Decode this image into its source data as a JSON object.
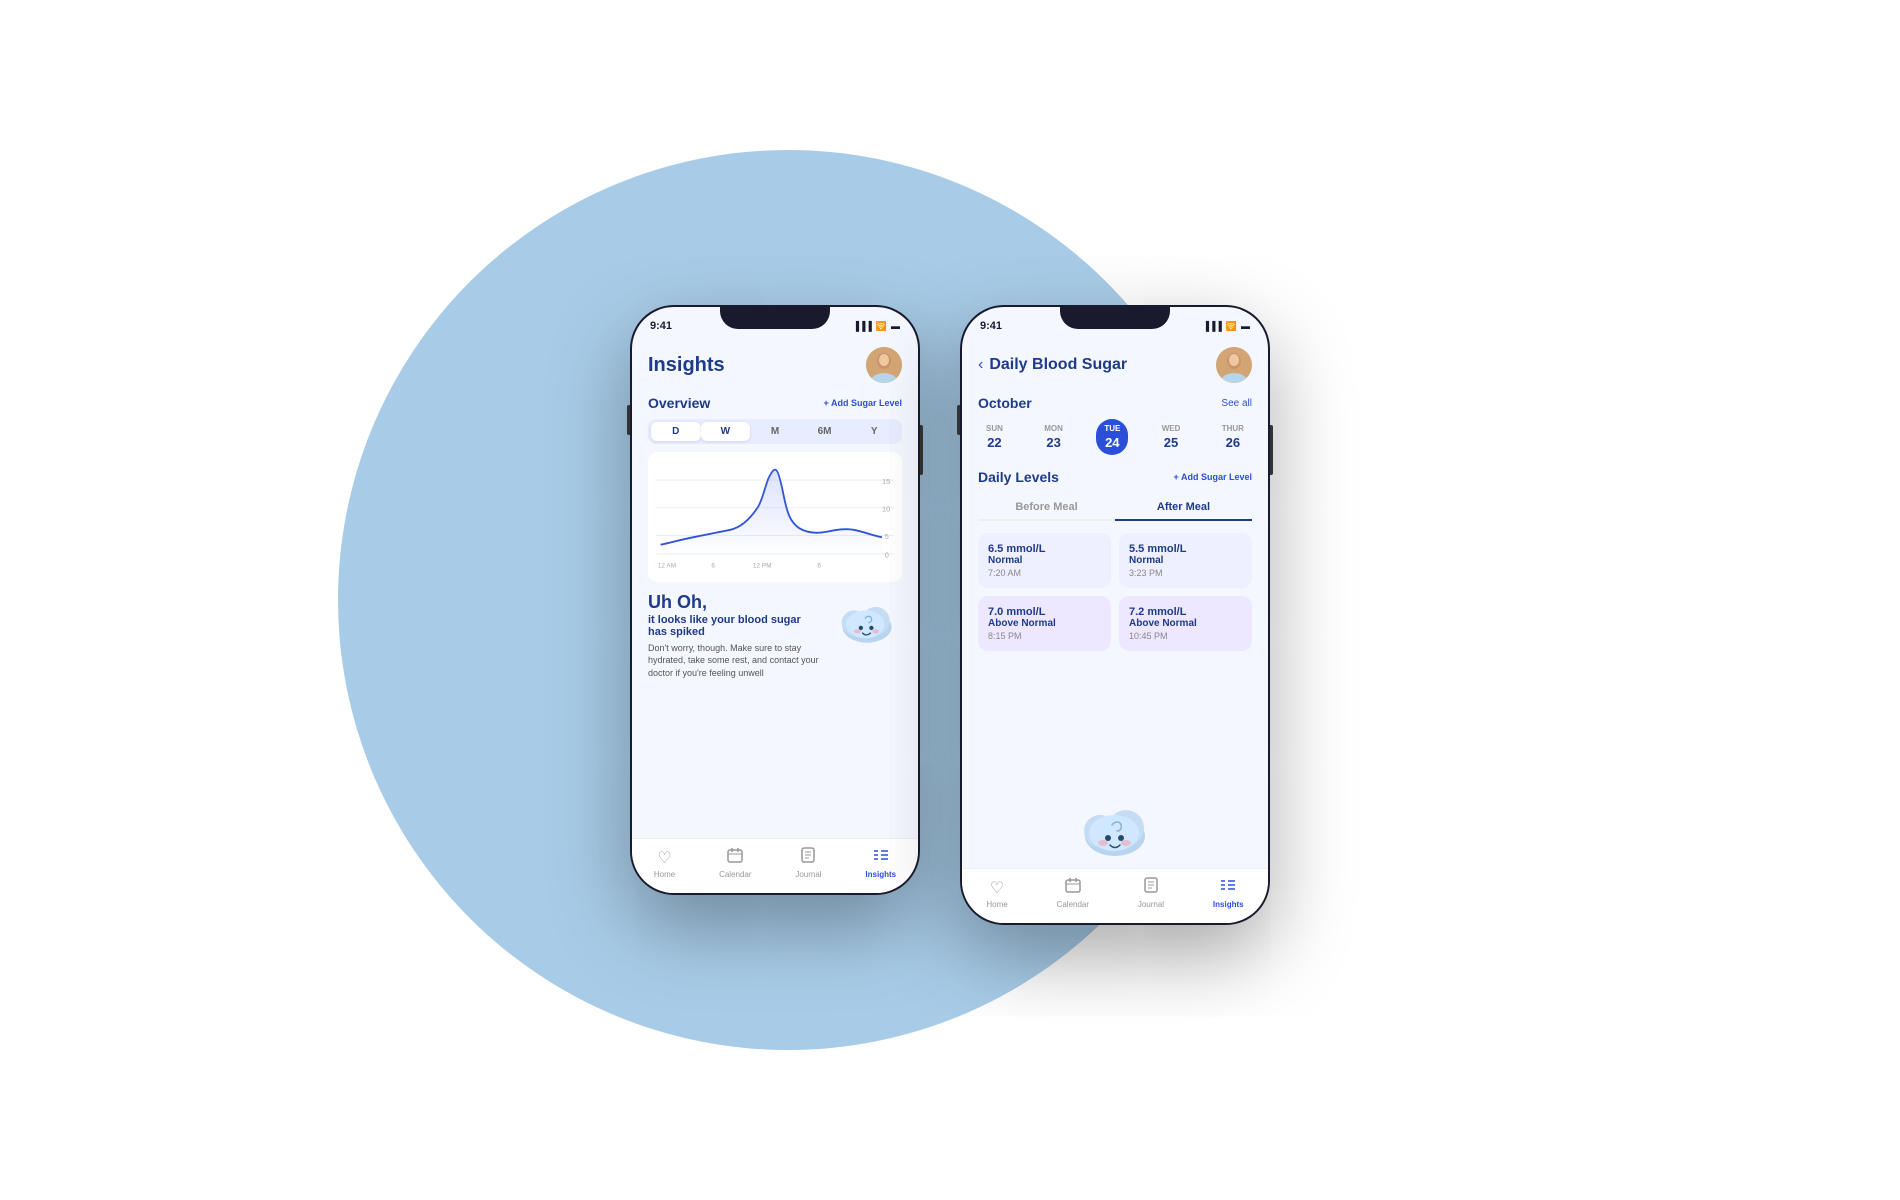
{
  "background": {
    "circle_color": "#a8cce8"
  },
  "phone1": {
    "status": {
      "time": "9:41",
      "icons": "●●● ▲ ▬"
    },
    "header": {
      "title": "Insights",
      "avatar_emoji": "👵"
    },
    "overview": {
      "label": "Overview",
      "add_btn": "+ Add Sugar Level"
    },
    "filters": [
      "D",
      "W",
      "M",
      "6M",
      "Y"
    ],
    "active_filter": "W",
    "alert": {
      "title": "Uh Oh,",
      "subtitle": "it looks like your blood sugar has spiked",
      "body": "Don't worry, though. Make sure to stay hydrated, take some rest, and contact your doctor if you're feeling unwell"
    },
    "nav": {
      "items": [
        "Home",
        "Calendar",
        "Journal",
        "Insights"
      ],
      "active": "Insights",
      "icons": [
        "♡",
        "📅",
        "📋",
        "≡"
      ]
    }
  },
  "phone2": {
    "status": {
      "time": "9:41",
      "icons": "●●● ▲ ▬"
    },
    "header": {
      "back": "‹",
      "title": "Daily Blood Sugar",
      "avatar_emoji": "👵"
    },
    "calendar": {
      "month": "October",
      "see_all": "See all",
      "dates": [
        {
          "day": "SUN",
          "num": "22"
        },
        {
          "day": "MON",
          "num": "23"
        },
        {
          "day": "TUE",
          "num": "24",
          "active": true
        },
        {
          "day": "WED",
          "num": "25"
        },
        {
          "day": "THUR",
          "num": "26"
        }
      ]
    },
    "daily_levels": {
      "label": "Daily Levels",
      "add_btn": "+ Add Sugar Level"
    },
    "meal_tabs": [
      "Before Meal",
      "After Meal"
    ],
    "active_tab": "After Meal",
    "sugar_cards": [
      {
        "value": "6.5 mmol/L",
        "status": "Normal",
        "time": "7:20 AM",
        "type": "normal"
      },
      {
        "value": "5.5 mmol/L",
        "status": "Normal",
        "time": "3:23 PM",
        "type": "normal"
      },
      {
        "value": "7.0 mmol/L",
        "status": "Above Normal",
        "time": "8:15 PM",
        "type": "above"
      },
      {
        "value": "7.2 mmol/L",
        "status": "Above Normal",
        "time": "10:45 PM",
        "type": "above"
      }
    ],
    "nav": {
      "items": [
        "Home",
        "Calendar",
        "Journal",
        "Insights"
      ],
      "active": "Insights",
      "icons": [
        "♡",
        "📅",
        "📋",
        "≡"
      ]
    }
  }
}
